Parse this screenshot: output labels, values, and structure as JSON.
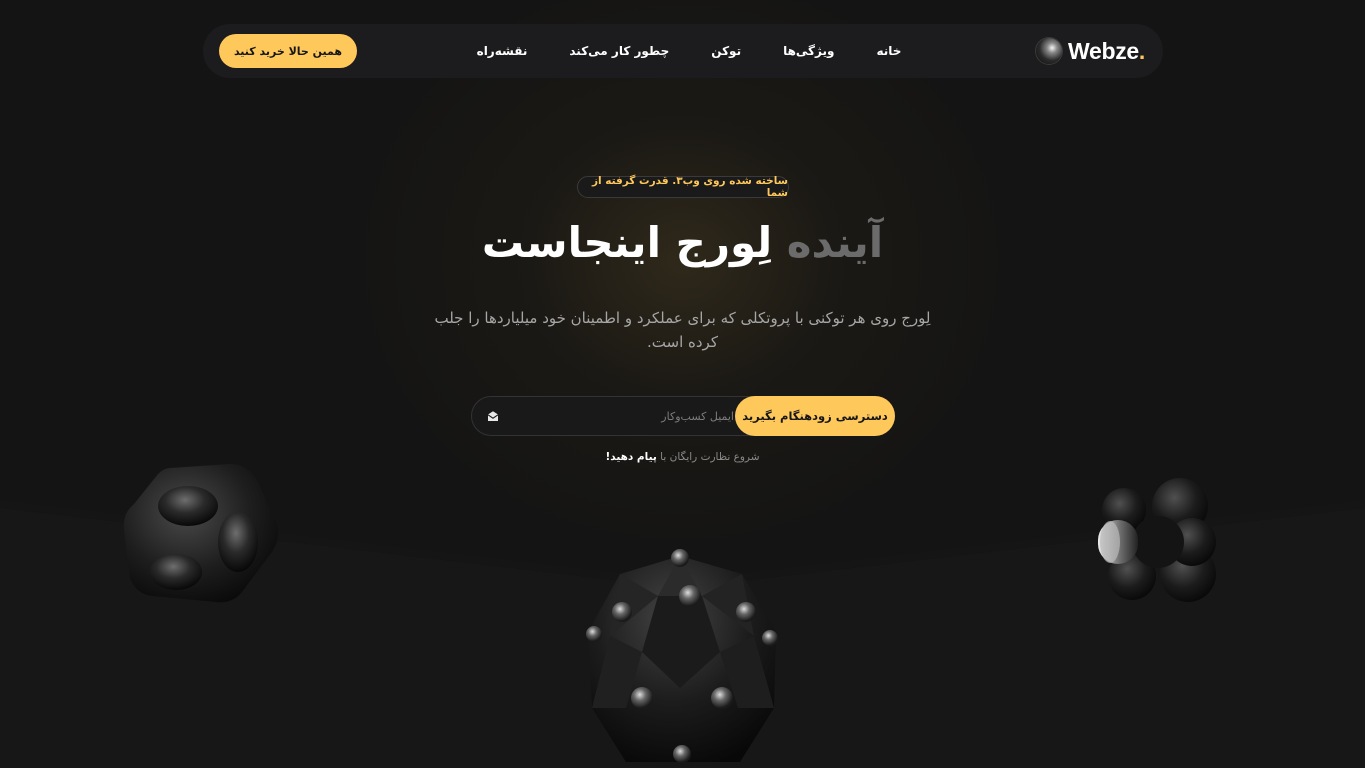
{
  "brand": {
    "name": "Webze",
    "dot": ".",
    "accent": "#ffc85a"
  },
  "nav": {
    "links": [
      "خانه",
      "ویژگی‌ها",
      "توکن",
      "چطور کار می‌کند",
      "نقشه‌راه"
    ],
    "cta_label": "همین حالا خرید کنید"
  },
  "hero": {
    "badge": "ساخته شده روی وب۳. قدرت گرفته از شما",
    "title_dim": "آینده",
    "title_bright": "لِورج اینجاست",
    "subtitle": "لِورج روی هر توکنی با پروتکلی که برای عملکرد و اطمینان خود میلیاردها را جلب کرده است.",
    "email_placeholder": "ایمیل کسب‌وکار",
    "submit_label": "دسترسی زودهنگام بگیرید",
    "hint_text": "شروع نظارت رایگان با",
    "hint_link": "پیام دهید!"
  },
  "icons": {
    "email": "envelope-icon",
    "logo": "sphere-logo-icon"
  }
}
